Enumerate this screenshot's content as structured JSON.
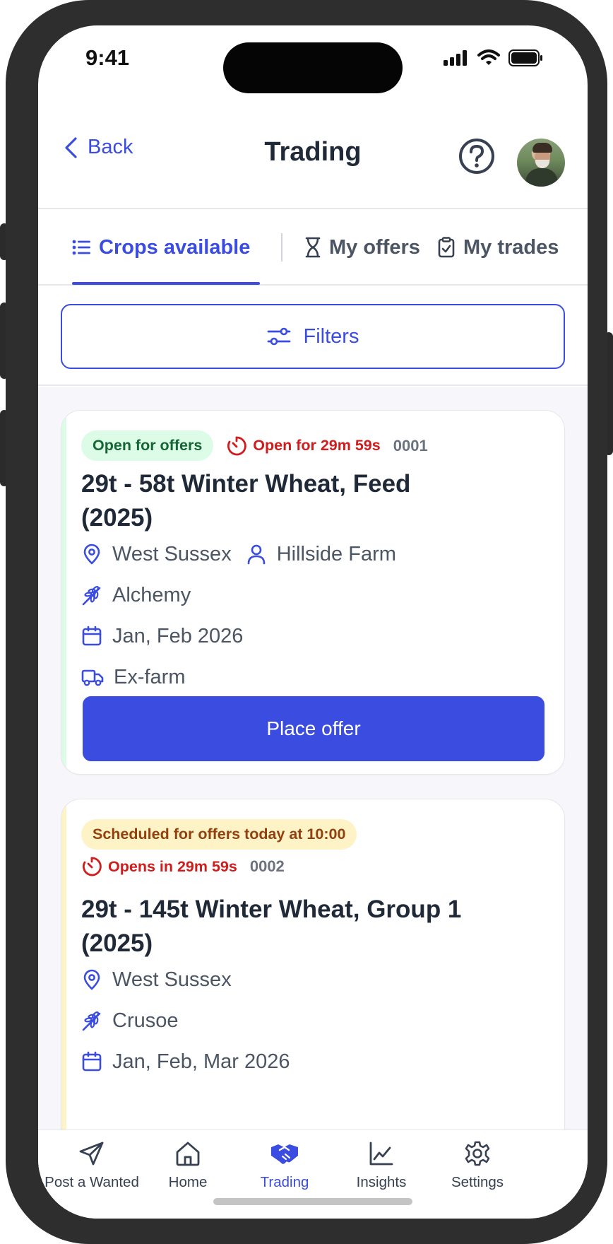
{
  "status_bar": {
    "time": "9:41"
  },
  "header": {
    "back_label": "Back",
    "title": "Trading"
  },
  "tabs": [
    {
      "label": "Crops available",
      "icon": "list-icon",
      "active": true
    },
    {
      "label": "My offers",
      "icon": "hourglass-icon",
      "active": false
    },
    {
      "label": "My trades",
      "icon": "clipboard-check-icon",
      "active": false
    }
  ],
  "filters": {
    "label": "Filters"
  },
  "listings": [
    {
      "status": "Open for offers",
      "timer": "Open for 29m 59s",
      "ref": "0001",
      "title": "29t - 58t Winter Wheat, Feed (2025)",
      "location": "West Sussex",
      "farm": "Hillside Farm",
      "variety": "Alchemy",
      "dates": "Jan, Feb 2026",
      "delivery": "Ex-farm",
      "action": "Place offer"
    },
    {
      "status": "Scheduled for offers today at 10:00",
      "timer": "Opens in 29m 59s",
      "ref": "0002",
      "title": "29t - 145t Winter Wheat, Group 1 (2025)",
      "location": "West Sussex",
      "variety": "Crusoe",
      "dates": "Jan, Feb, Mar 2026"
    }
  ],
  "bottom_nav": [
    {
      "label": "Post a Wanted",
      "icon": "send-icon",
      "active": false
    },
    {
      "label": "Home",
      "icon": "home-icon",
      "active": false
    },
    {
      "label": "Trading",
      "icon": "handshake-icon",
      "active": true
    },
    {
      "label": "Insights",
      "icon": "line-chart-icon",
      "active": false
    },
    {
      "label": "Settings",
      "icon": "gear-icon",
      "active": false
    }
  ],
  "colors": {
    "accent": "#3b4ce0",
    "open_badge_bg": "#dcfce7",
    "open_badge_text": "#166534",
    "scheduled_badge_bg": "#fef3c7",
    "scheduled_badge_text": "#92400e",
    "timer_red": "#d01c1c"
  }
}
